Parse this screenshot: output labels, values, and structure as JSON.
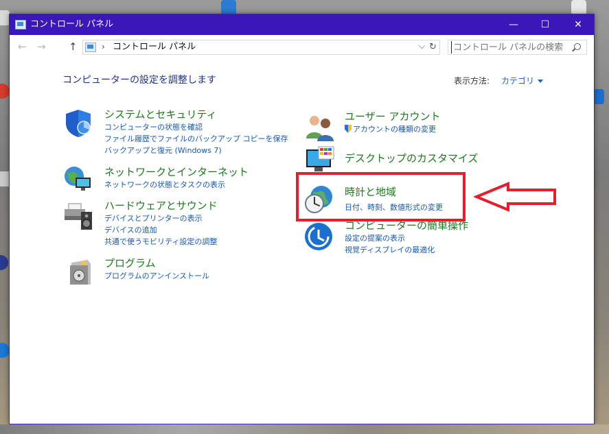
{
  "window": {
    "title": "コントロール パネル",
    "minimize": "—",
    "maximize": "☐",
    "close": "✕"
  },
  "nav": {
    "back": "←",
    "forward": "→",
    "up": "↑",
    "address_separator": "›",
    "address": "コントロール パネル",
    "dropdown": "⌵",
    "refresh": "↻",
    "search_placeholder": "コントロール パネルの検索"
  },
  "content": {
    "heading": "コンピューターの設定を調整します",
    "view_by_label": "表示方法:",
    "view_by_value": "カテゴリ"
  },
  "categories_left": [
    {
      "title": "システムとセキュリティ",
      "icon": "shield-icon",
      "links": [
        "コンピューターの状態を確認",
        "ファイル履歴でファイルのバックアップ コピーを保存",
        "バックアップと復元 (Windows 7)"
      ]
    },
    {
      "title": "ネットワークとインターネット",
      "icon": "network-globe-icon",
      "links": [
        "ネットワークの状態とタスクの表示"
      ]
    },
    {
      "title": "ハードウェアとサウンド",
      "icon": "printer-speaker-icon",
      "links": [
        "デバイスとプリンターの表示",
        "デバイスの追加",
        "共通で使うモビリティ設定の調整"
      ]
    },
    {
      "title": "プログラム",
      "icon": "programs-box-icon",
      "links": [
        "プログラムのアンインストール"
      ]
    }
  ],
  "categories_right": [
    {
      "title": "ユーザー アカウント",
      "icon": "users-icon",
      "links": [
        "アカウントの種類の変更"
      ]
    },
    {
      "title": "デスクトップのカスタマイズ",
      "icon": "monitor-icon",
      "links": []
    },
    {
      "title": "時計と地域",
      "icon": "clock-globe-icon",
      "links": [
        "日付、時刻、数値形式の変更"
      ]
    },
    {
      "title": "コンピューターの簡単操作",
      "icon": "ease-of-access-icon",
      "links": [
        "設定の提案の表示",
        "視覚ディスプレイの最適化"
      ]
    }
  ],
  "colors": {
    "titlebar": "#3b16b8",
    "category_title": "#1a7a1a",
    "link": "#1659b0",
    "annotation": "#e41e2b"
  }
}
